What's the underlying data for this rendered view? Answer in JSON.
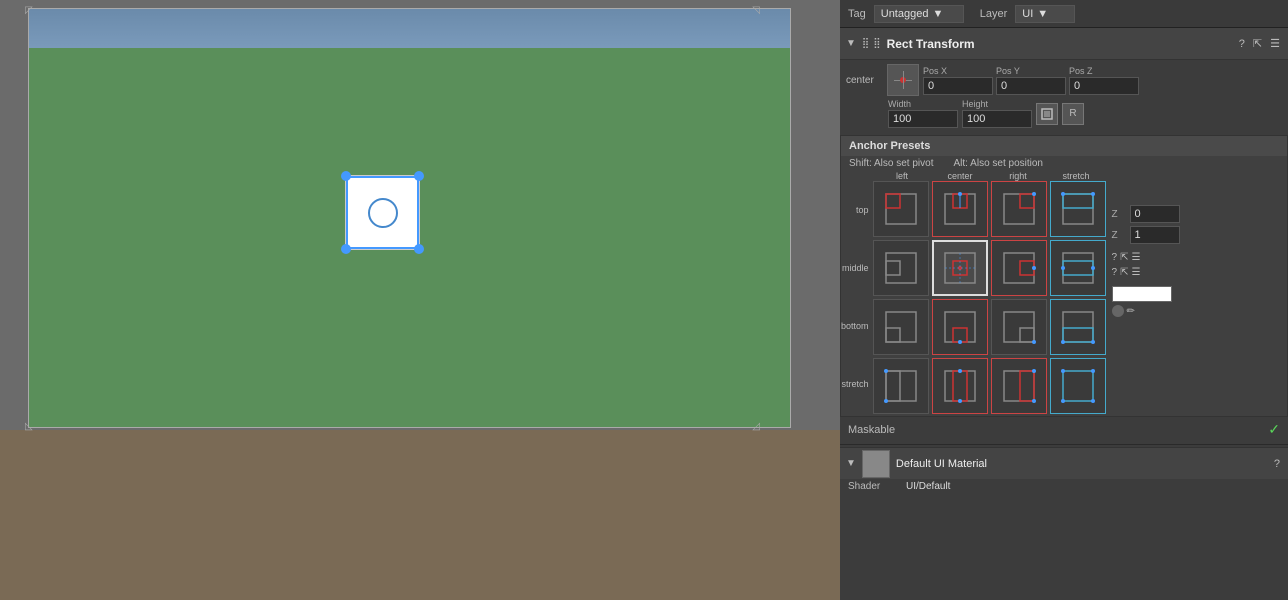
{
  "scene": {
    "background_color": "#5a8f5a"
  },
  "inspector": {
    "tag_label": "Tag",
    "tag_value": "Untagged",
    "layer_label": "Layer",
    "layer_value": "UI",
    "component": {
      "title": "Rect Transform",
      "pivot_label": "center",
      "middle_label": "middle",
      "pos_x_label": "Pos X",
      "pos_x_value": "0",
      "pos_y_label": "Pos Y",
      "pos_y_value": "0",
      "pos_z_label": "Pos Z",
      "pos_z_value": "0",
      "width_label": "Width",
      "width_value": "100",
      "height_label": "Height",
      "height_value": "100"
    },
    "anchor_presets": {
      "title": "Anchor Presets",
      "shift_text": "Shift: Also set pivot",
      "alt_text": "Alt: Also set position",
      "col_labels": [
        "left",
        "center",
        "right",
        "stretch"
      ],
      "row_labels": [
        "top",
        "middle",
        "bottom",
        "stretch"
      ]
    },
    "z_order_label_0": "Z",
    "z_order_value_0": "0",
    "z_order_label_1": "Z",
    "z_order_value_1": "1",
    "maskable_label": "Maskable",
    "material": {
      "name": "Default UI Material",
      "shader_label": "Shader",
      "shader_value": "UI/Default"
    }
  }
}
